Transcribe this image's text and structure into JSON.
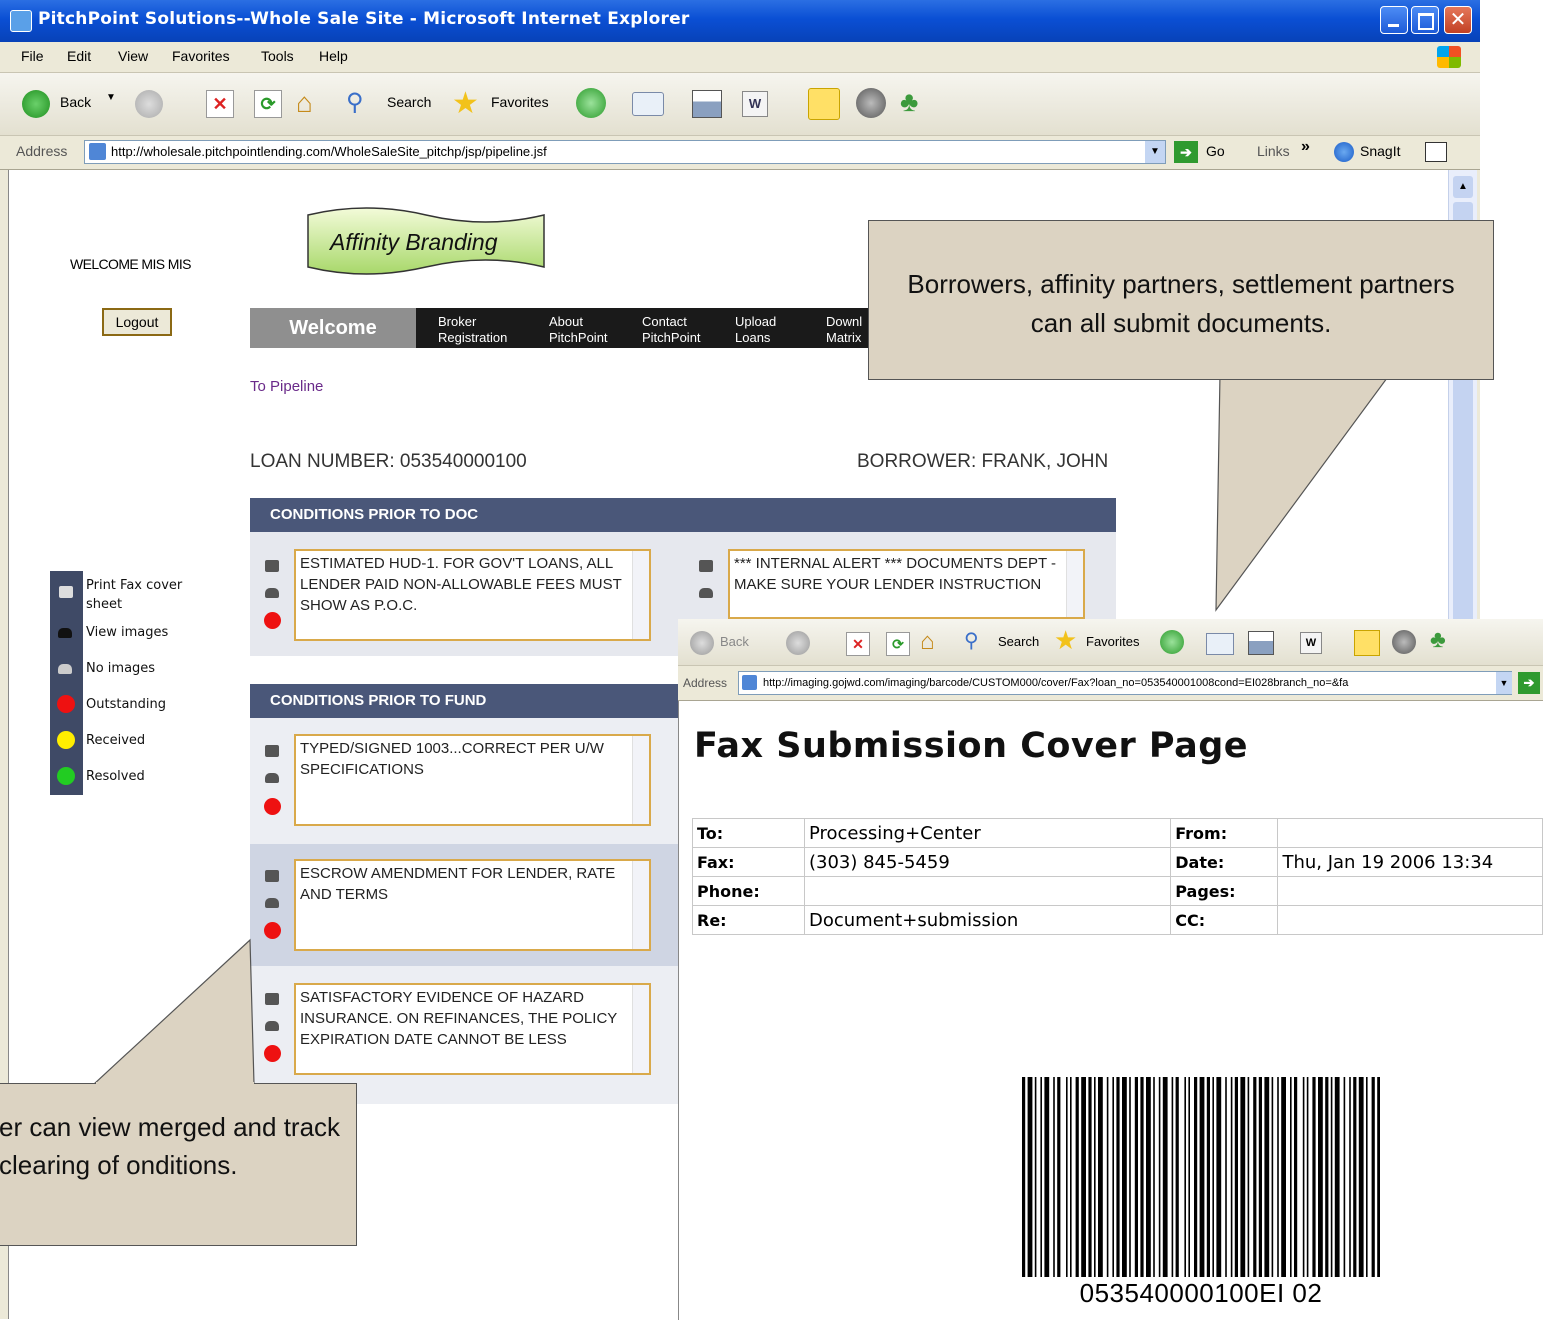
{
  "window": {
    "title": "PitchPoint Solutions--Whole Sale Site - Microsoft Internet Explorer"
  },
  "menu": [
    "File",
    "Edit",
    "View",
    "Favorites",
    "Tools",
    "Help"
  ],
  "toolbar": {
    "back": "Back",
    "search": "Search",
    "favorites": "Favorites"
  },
  "address": {
    "label": "Address",
    "url": "http://wholesale.pitchpointlending.com/WholeSaleSite_pitchp/jsp/pipeline.jsf",
    "go": "Go",
    "links": "Links",
    "snagit": "SnagIt"
  },
  "page": {
    "welcome_user": "WELCOME MIS MIS",
    "logout": "Logout",
    "branding": "Affinity Branding",
    "nav": {
      "welcome": "Welcome",
      "items": [
        {
          "line1": "Broker",
          "line2": "Registration"
        },
        {
          "line1": "About",
          "line2": "PitchPoint"
        },
        {
          "line1": "Contact",
          "line2": "PitchPoint"
        },
        {
          "line1": "Upload",
          "line2": "Loans"
        },
        {
          "line1": "Downl",
          "line2": "Matrix"
        }
      ]
    },
    "to_pipeline": "To Pipeline",
    "loan_number": "LOAN NUMBER: 053540000100",
    "borrower": "BORROWER: FRANK, JOHN",
    "sections": {
      "prior_doc": {
        "title": "CONDITIONS PRIOR TO DOC",
        "conditions": [
          "ESTIMATED HUD-1.  FOR GOV'T LOANS, ALL LENDER PAID NON-ALLOWABLE FEES MUST SHOW AS P.O.C.",
          "*** INTERNAL ALERT ***  DOCUMENTS DEPT - MAKE SURE YOUR LENDER INSTRUCTION"
        ]
      },
      "prior_fund": {
        "title": "CONDITIONS PRIOR TO FUND",
        "conditions": [
          "TYPED/SIGNED 1003...CORRECT PER U/W SPECIFICATIONS",
          "ESCROW AMENDMENT FOR LENDER, RATE AND TERMS",
          "SATISFACTORY EVIDENCE OF HAZARD INSURANCE.  ON REFINANCES, THE POLICY EXPIRATION DATE CANNOT BE LESS"
        ]
      }
    },
    "legend": [
      {
        "label": "Print Fax cover sheet",
        "icon": "printer-icon"
      },
      {
        "label": "View images",
        "icon": "view-images-icon"
      },
      {
        "label": "No images",
        "icon": "no-images-icon"
      },
      {
        "label": "Outstanding",
        "color": "#ee1111"
      },
      {
        "label": "Received",
        "color": "#ffee00"
      },
      {
        "label": "Resolved",
        "color": "#22cc22"
      }
    ]
  },
  "callouts": {
    "top": "Borrowers, affinity partners, settlement partners can all submit documents.",
    "bottom": "er can view merged and track clearing of onditions."
  },
  "popup": {
    "toolbar": {
      "back": "Back",
      "search": "Search",
      "favorites": "Favorites"
    },
    "address_label": "Address",
    "url": "http://imaging.gojwd.com/imaging/barcode/CUSTOM000/cover/Fax?loan_no=053540001008cond=EI028branch_no=&fa",
    "title": "Fax Submission Cover Page",
    "fields": [
      {
        "k1": "To:",
        "v1": "Processing+Center",
        "k2": "From:",
        "v2": ""
      },
      {
        "k1": "Fax:",
        "v1": "(303) 845-5459",
        "k2": "Date:",
        "v2": "Thu, Jan 19 2006 13:34"
      },
      {
        "k1": "Phone:",
        "v1": "",
        "k2": "Pages:",
        "v2": ""
      },
      {
        "k1": "Re:",
        "v1": "Document+submission",
        "k2": "CC:",
        "v2": ""
      }
    ],
    "barcode_text": "053540000100EI 02"
  },
  "colors": {
    "titlebar": "#0a4fd4",
    "section_header": "#4a5779",
    "condition_border": "#d9a94a",
    "callout_bg": "#dcd3c2"
  }
}
